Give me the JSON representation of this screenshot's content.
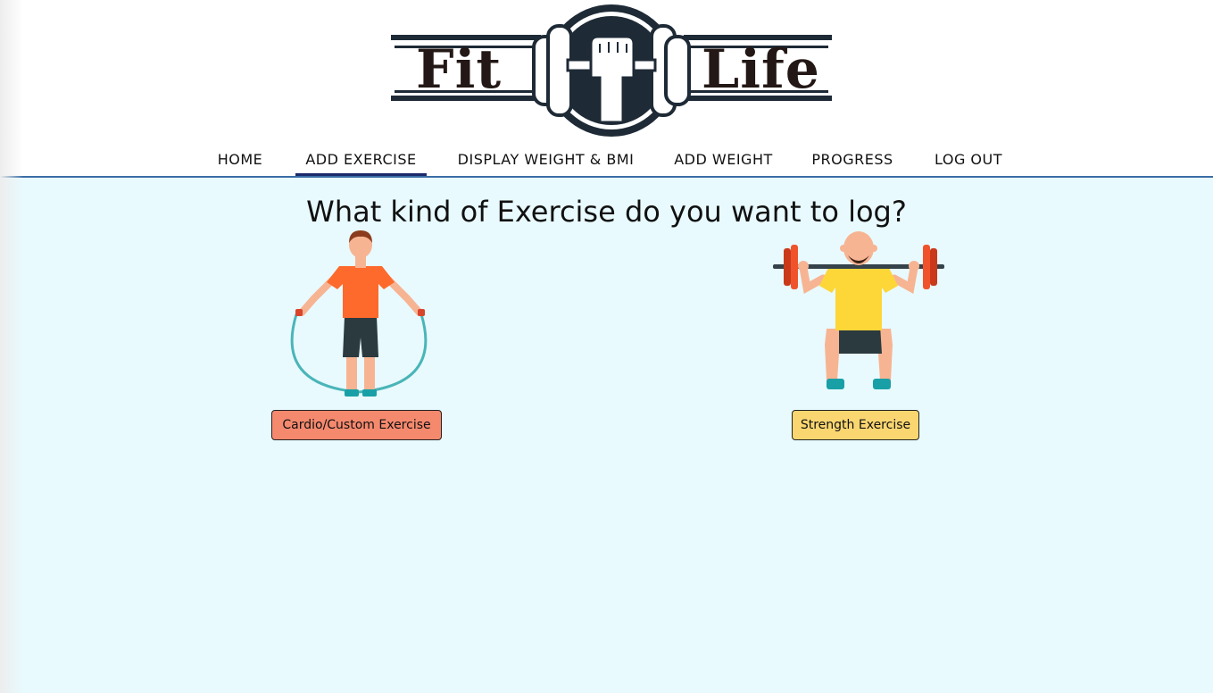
{
  "brand": {
    "logo_word_left": "Fit",
    "logo_word_right": "Life",
    "logo_icon": "fist-dumbbell-icon"
  },
  "nav": {
    "items": [
      {
        "label": "HOME"
      },
      {
        "label": "ADD EXERCISE",
        "active": true
      },
      {
        "label": "DISPLAY WEIGHT & BMI"
      },
      {
        "label": "ADD WEIGHT"
      },
      {
        "label": "PROGRESS"
      },
      {
        "label": "LOG OUT"
      }
    ]
  },
  "main": {
    "heading": "What kind of Exercise do you want to log?",
    "options": [
      {
        "label": "Cardio/Custom Exercise",
        "illustration": "jump-rope-icon"
      },
      {
        "label": "Strength Exercise",
        "illustration": "barbell-squat-icon"
      }
    ]
  },
  "colors": {
    "page_background": "#e8fafe",
    "header_rule": "#3a6ea5",
    "active_underline": "#1b2a6b",
    "cardio_button": "#f5896e",
    "strength_button": "#fad671",
    "logo_dark": "#231815"
  }
}
